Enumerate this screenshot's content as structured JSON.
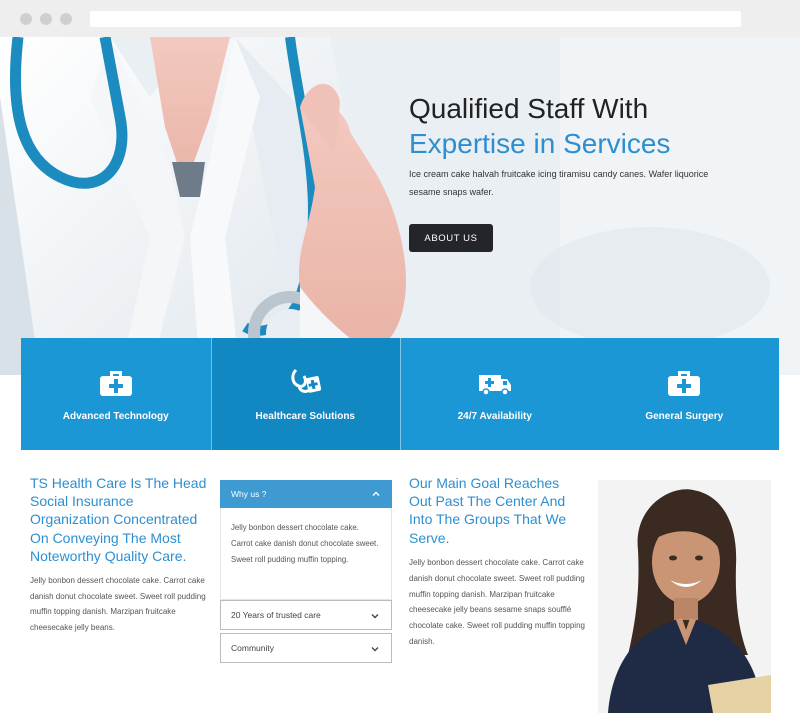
{
  "hero": {
    "title_line1": "Qualified Staff With",
    "title_line2": "Expertise in Services",
    "description": "Ice cream cake halvah fruitcake icing tiramisu candy canes. Wafer liquorice sesame snaps wafer.",
    "button_label": "ABOUT US"
  },
  "features": [
    {
      "label": "Advanced Technology",
      "icon": "medical-kit-icon"
    },
    {
      "label": "Healthcare Solutions",
      "icon": "stethoscope-icon"
    },
    {
      "label": "24/7 Availability",
      "icon": "ambulance-icon"
    },
    {
      "label": "General Surgery",
      "icon": "medical-kit-icon"
    }
  ],
  "intro": {
    "title": "TS Health Care Is The Head Social Insurance Organization Concentrated On Conveying The Most Noteworthy Quality Care.",
    "text": "Jelly bonbon dessert chocolate cake. Carrot cake danish donut chocolate sweet. Sweet roll pudding muffin topping danish. Marzipan fruitcake cheesecake jelly beans."
  },
  "accordion": {
    "open": {
      "title": "Why us ?",
      "body": "Jelly bonbon dessert chocolate cake. Carrot cake danish donut chocolate sweet. Sweet roll pudding muffin topping."
    },
    "items": [
      {
        "title": "20 Years of trusted care"
      },
      {
        "title": "Community"
      }
    ]
  },
  "goal": {
    "title": "Our Main Goal Reaches Out Past The Center And Into The Groups That We Serve.",
    "text": "Jelly bonbon dessert chocolate cake. Carrot cake danish donut chocolate sweet. Sweet roll pudding muffin topping danish. Marzipan fruitcake cheesecake jelly beans sesame snaps soufflé chocolate cake. Sweet roll pudding muffin topping danish."
  },
  "colors": {
    "accent": "#2d8fd0",
    "feature_bg": "#1a97d4",
    "feature_active_bg": "#1288c3",
    "button_bg": "#23252a"
  }
}
